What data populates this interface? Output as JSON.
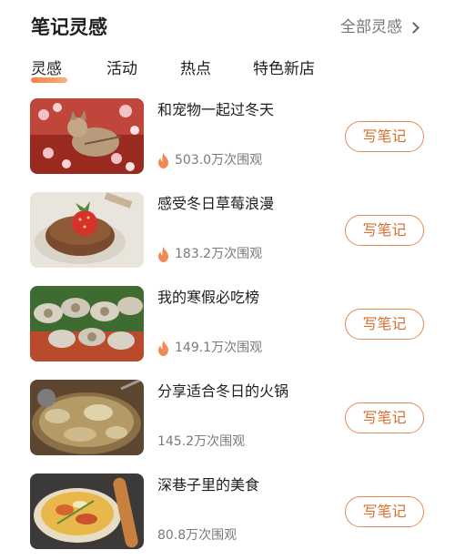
{
  "header": {
    "title": "笔记灵感",
    "all_link_label": "全部灵感"
  },
  "tabs": [
    {
      "label": "灵感",
      "active": true
    },
    {
      "label": "活动",
      "active": false
    },
    {
      "label": "热点",
      "active": false
    },
    {
      "label": "特色新店",
      "active": false
    }
  ],
  "colors": {
    "accent": "#e58a52",
    "tab_underline": "#f4742f",
    "fire_icon": "#f08a55"
  },
  "items": [
    {
      "title": "和宠物一起过冬天",
      "views": "503.0万次围观",
      "hot": true,
      "button_label": "写笔记",
      "image": "cat-in-plum-blossoms"
    },
    {
      "title": "感受冬日草莓浪漫",
      "views": "183.2万次围观",
      "hot": true,
      "button_label": "写笔记",
      "image": "strawberry-cake"
    },
    {
      "title": "我的寒假必吃榜",
      "views": "149.1万次围观",
      "hot": true,
      "button_label": "写笔记",
      "image": "oysters-platter"
    },
    {
      "title": "分享适合冬日的火锅",
      "views": "145.2万次围观",
      "hot": false,
      "button_label": "写笔记",
      "image": "hot-pot"
    },
    {
      "title": "深巷子里的美食",
      "views": "80.8万次围观",
      "hot": false,
      "button_label": "写笔记",
      "image": "street-food-pancake"
    }
  ]
}
